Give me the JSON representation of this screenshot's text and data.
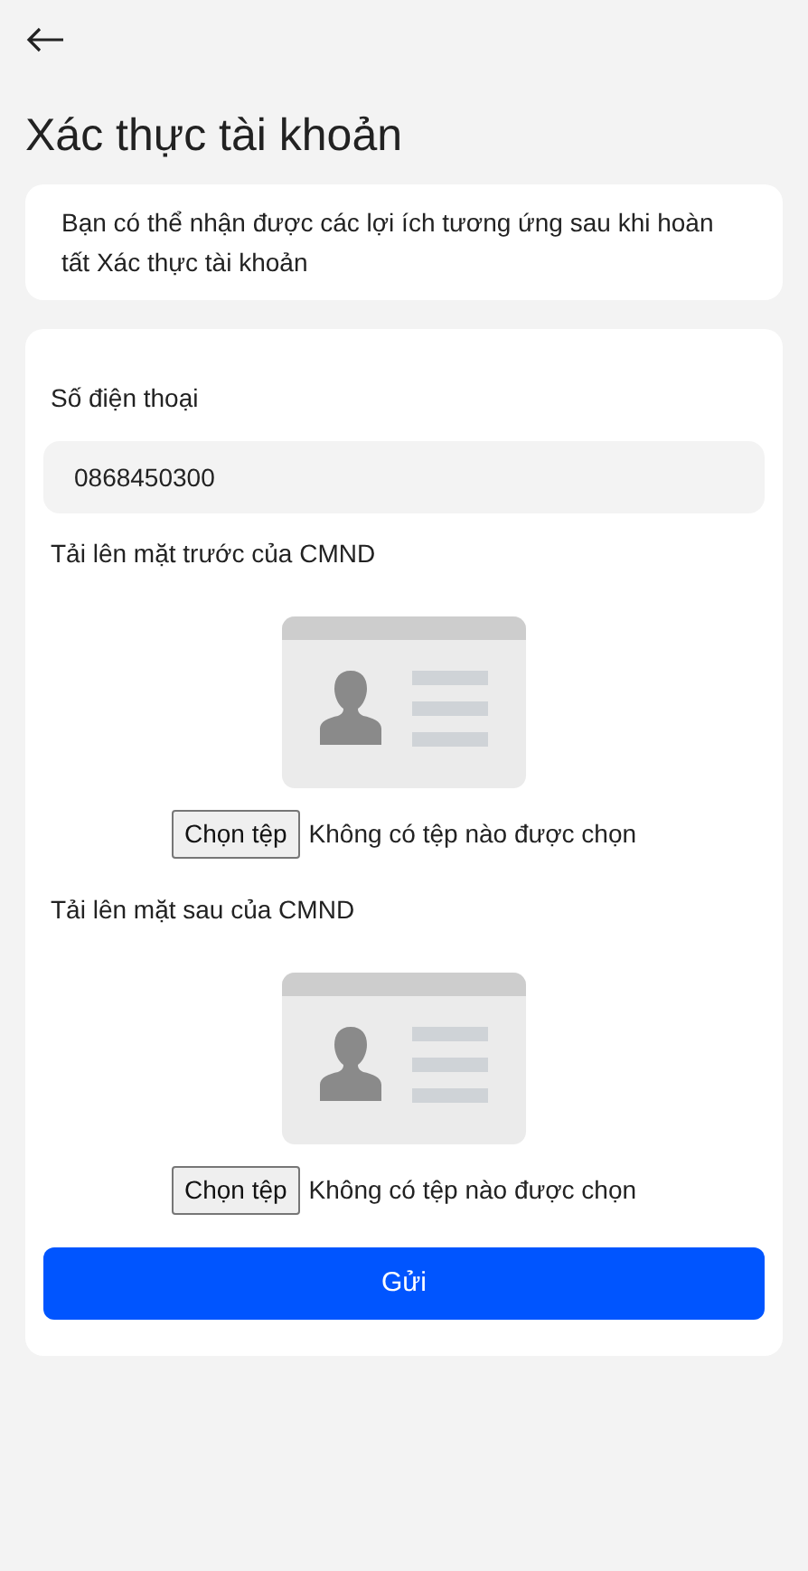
{
  "header": {
    "title": "Xác thực tài khoản"
  },
  "info": "Bạn có thể nhận được các lợi ích tương ứng sau khi hoàn tất Xác thực tài khoản",
  "phone": {
    "label": "Số điện thoại",
    "value": "0868450300"
  },
  "uploads": [
    {
      "label": "Tải lên mặt trước của CMND",
      "button": "Chọn tệp",
      "status": "Không có tệp nào được chọn"
    },
    {
      "label": "Tải lên mặt sau của CMND",
      "button": "Chọn tệp",
      "status": "Không có tệp nào được chọn"
    }
  ],
  "submit": "Gửi"
}
